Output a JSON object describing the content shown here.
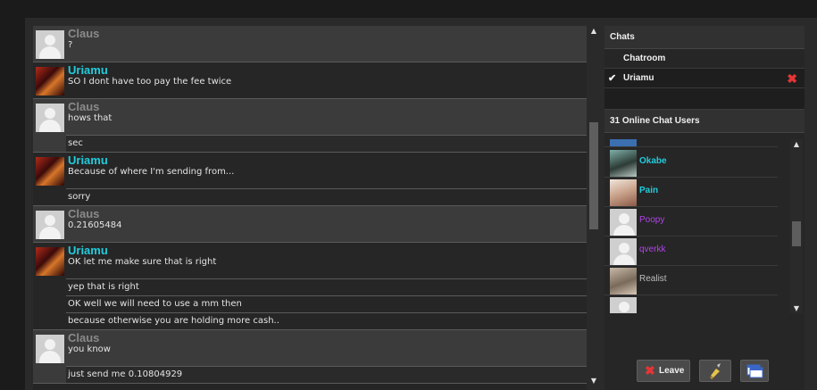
{
  "messages": {
    "groups": [
      {
        "user": "Claus",
        "kind": "claus",
        "lines": [
          "?"
        ]
      },
      {
        "user": "Uriamu",
        "kind": "uri",
        "lines": [
          "SO I dont have too pay the fee twice"
        ]
      },
      {
        "user": "Claus",
        "kind": "claus",
        "lines": [
          "hows that",
          "sec"
        ]
      },
      {
        "user": "Uriamu",
        "kind": "uri",
        "lines": [
          "Because of where I'm sending from...",
          "sorry"
        ]
      },
      {
        "user": "Claus",
        "kind": "claus",
        "lines": [
          "0.21605484"
        ]
      },
      {
        "user": "Uriamu",
        "kind": "uri",
        "lines": [
          "OK let me make sure that is right",
          "yep that is right",
          "OK well we will need to use a mm then",
          "because otherwise you are holding more cash.."
        ]
      },
      {
        "user": "Claus",
        "kind": "claus",
        "lines": [
          "you know",
          "just send me 0.10804929"
        ]
      }
    ]
  },
  "chats": {
    "title": "Chats",
    "items": [
      {
        "label": "Chatroom",
        "selected": false
      },
      {
        "label": "Uriamu",
        "selected": true
      }
    ]
  },
  "users": {
    "title": "31 Online Chat Users",
    "list": [
      {
        "name": "Okabe",
        "color": "#22ccdd",
        "bold": true
      },
      {
        "name": "Pain",
        "color": "#22ccdd",
        "bold": true
      },
      {
        "name": "Poopy",
        "color": "#b044e8",
        "bold": false
      },
      {
        "name": "qverkk",
        "color": "#b044e8",
        "bold": false
      },
      {
        "name": "Realist",
        "color": "#bdbdbd",
        "bold": false
      }
    ]
  },
  "actions": {
    "leave_label": "Leave"
  },
  "colors": {
    "claus_name": "#8a8a8a",
    "uriamu_name": "#22ccdd",
    "close_red": "#e53535"
  }
}
